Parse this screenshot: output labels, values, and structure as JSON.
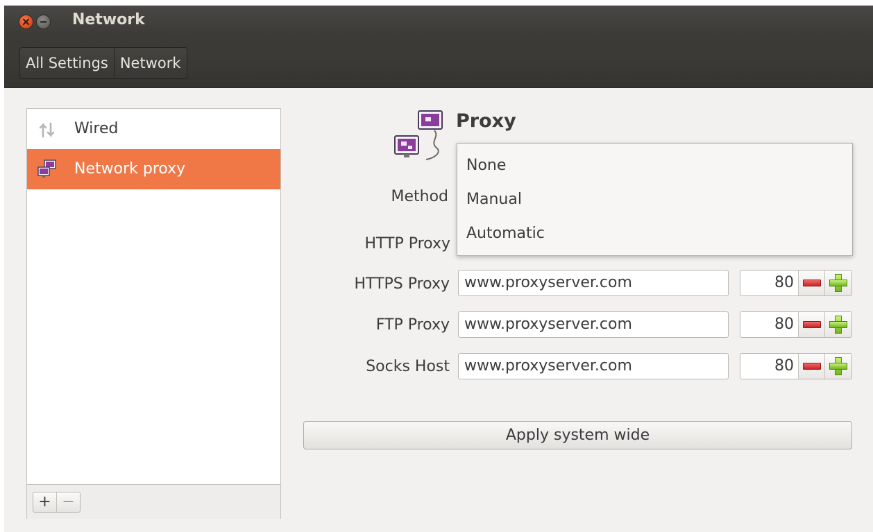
{
  "window": {
    "title": "Network"
  },
  "breadcrumbs": [
    "All Settings",
    "Network"
  ],
  "sidebar": {
    "items": [
      {
        "label": "Wired",
        "icon": "wired-icon",
        "selected": false
      },
      {
        "label": "Network proxy",
        "icon": "network-proxy-icon",
        "selected": true
      }
    ],
    "add_label": "+",
    "remove_label": "−"
  },
  "proxy": {
    "title": "Proxy",
    "method_label": "Method",
    "method_options": [
      "None",
      "Manual",
      "Automatic"
    ],
    "rows": [
      {
        "label": "HTTP Proxy"
      },
      {
        "label": "HTTPS Proxy",
        "host": "www.proxyserver.com",
        "port": "80"
      },
      {
        "label": "FTP Proxy",
        "host": "www.proxyserver.com",
        "port": "80"
      },
      {
        "label": "Socks Host",
        "host": "www.proxyserver.com",
        "port": "80"
      }
    ],
    "apply_label": "Apply system wide"
  },
  "colors": {
    "selection": "#f07746",
    "titlebar": "#3c3b37",
    "close": "#df4a16"
  }
}
